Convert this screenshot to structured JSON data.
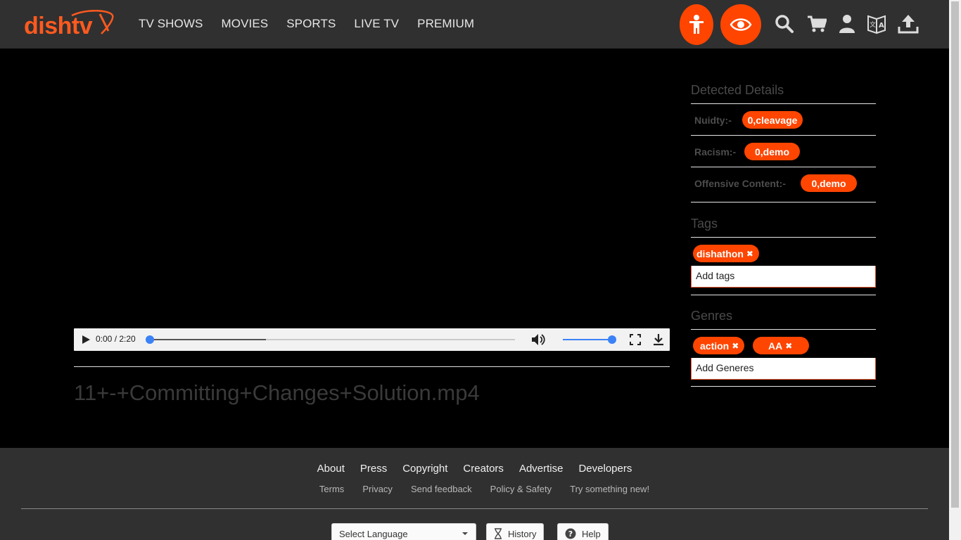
{
  "header": {
    "logo_text": "dishtv",
    "nav": [
      "TV SHOWS",
      "MOVIES",
      "SPORTS",
      "LIVE TV",
      "PREMIUM"
    ],
    "icons": [
      "kid-mode-icon",
      "eye-icon",
      "search-icon",
      "cart-icon",
      "user-icon",
      "translate-icon",
      "upload-icon"
    ]
  },
  "player": {
    "time": "0:00 / 2:20",
    "title": "11+-+Committing+Changes+Solution.mp4"
  },
  "detected": {
    "title": "Detected Details",
    "rows": [
      {
        "label": "Nuidty:-",
        "value": "0,cleavage"
      },
      {
        "label": "Racism:-",
        "value": "0,demo"
      },
      {
        "label": "Offensive Content:-",
        "value": "0,demo"
      }
    ]
  },
  "tags": {
    "title": "Tags",
    "items": [
      "dishathon"
    ],
    "placeholder": "Add tags"
  },
  "genres": {
    "title": "Genres",
    "items": [
      "action",
      "AA"
    ],
    "placeholder": "Add Generes"
  },
  "footer": {
    "links_primary": [
      "About",
      "Press",
      "Copyright",
      "Creators",
      "Advertise",
      "Developers"
    ],
    "links_secondary": [
      "Terms",
      "Privacy",
      "Send feedback",
      "Policy & Safety",
      "Try something new!"
    ],
    "language_select": "Select Language",
    "history_label": "History",
    "help_label": "Help"
  },
  "colors": {
    "accent": "#ff4500",
    "header_bg": "#303030"
  }
}
